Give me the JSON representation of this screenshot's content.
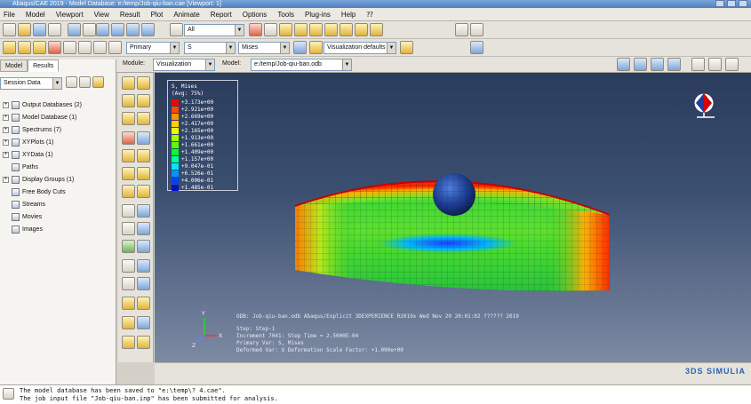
{
  "window": {
    "title": "Abaqus/CAE 2019 - Model Database: e:/temp/Job-qiu-ban.cae [Viewport: 1]"
  },
  "menu": [
    "File",
    "Model",
    "Viewport",
    "View",
    "Result",
    "Plot",
    "Animate",
    "Report",
    "Options",
    "Tools",
    "Plug-ins",
    "Help",
    "⁇"
  ],
  "toolbar2": {
    "selection_filter": "All"
  },
  "toolbar3": {
    "step_type": "Primary",
    "frame": "S",
    "variable": "Mises",
    "visualization": "Visualization defaults"
  },
  "context": {
    "module_label": "Module:",
    "module_value": "Visualization",
    "model_label": "Model:",
    "model_value": "e:/temp/Job-qiu-ban.odb"
  },
  "left_panel": {
    "tabs": [
      "Model",
      "Results"
    ],
    "active_tab": "Results",
    "session_combo": "Session Data",
    "tree": [
      {
        "label": "Output Databases (2)",
        "expandable": true
      },
      {
        "label": "Model Database (1)",
        "expandable": true
      },
      {
        "label": "Spectrums (7)",
        "expandable": true
      },
      {
        "label": "XYPlots (1)",
        "expandable": true
      },
      {
        "label": "XYData (1)",
        "expandable": true
      },
      {
        "label": "Paths",
        "expandable": false
      },
      {
        "label": "Display Groups (1)",
        "expandable": true
      },
      {
        "label": "Free Body Cuts",
        "expandable": false
      },
      {
        "label": "Streams",
        "expandable": false
      },
      {
        "label": "Movies",
        "expandable": false
      },
      {
        "label": "Images",
        "expandable": false
      }
    ]
  },
  "legend": {
    "title": "S, Mises",
    "subtitle": "(Avg: 75%)",
    "values": [
      "+3.173e+00",
      "+2.921e+00",
      "+2.669e+00",
      "+2.417e+00",
      "+2.165e+00",
      "+1.913e+00",
      "+1.661e+00",
      "+1.409e+00",
      "+1.157e+00",
      "+9.047e-01",
      "+6.526e-01",
      "+4.006e-01",
      "+1.485e-01"
    ],
    "colors": [
      "#ff0000",
      "#ff4a00",
      "#ff9200",
      "#ffd000",
      "#eaff00",
      "#a6ff00",
      "#5cff00",
      "#00ff2b",
      "#00ff9a",
      "#00e4ff",
      "#0094ff",
      "#0042ff",
      "#0010c8"
    ]
  },
  "viewport_info": {
    "odb_line": "ODB: Job-qiu-ban.odb    Abaqus/Explicit 3DEXPERIENCE R2019x    Wed Nov 20 20:01:02 ?????? 2019",
    "step_line": "Step: Step-1",
    "increment_line": "Increment     7041: Step Time =    2.5000E-04",
    "primary_line": "Primary Var: S, Mises",
    "deformed_line": "Deformed Var: U   Deformation Scale Factor: +1.000e+00"
  },
  "brand": "3DS SIMULIA",
  "messages": [
    "The model database has been saved to \"e:\\temp\\? 4.cae\".",
    "The job input file \"Job-qiu-ban.inp\" has been submitted for analysis."
  ],
  "colors": {
    "viewport_top": "#2b3c5c",
    "viewport_bottom": "#7d8aa3",
    "accent": "#2a62b8"
  }
}
